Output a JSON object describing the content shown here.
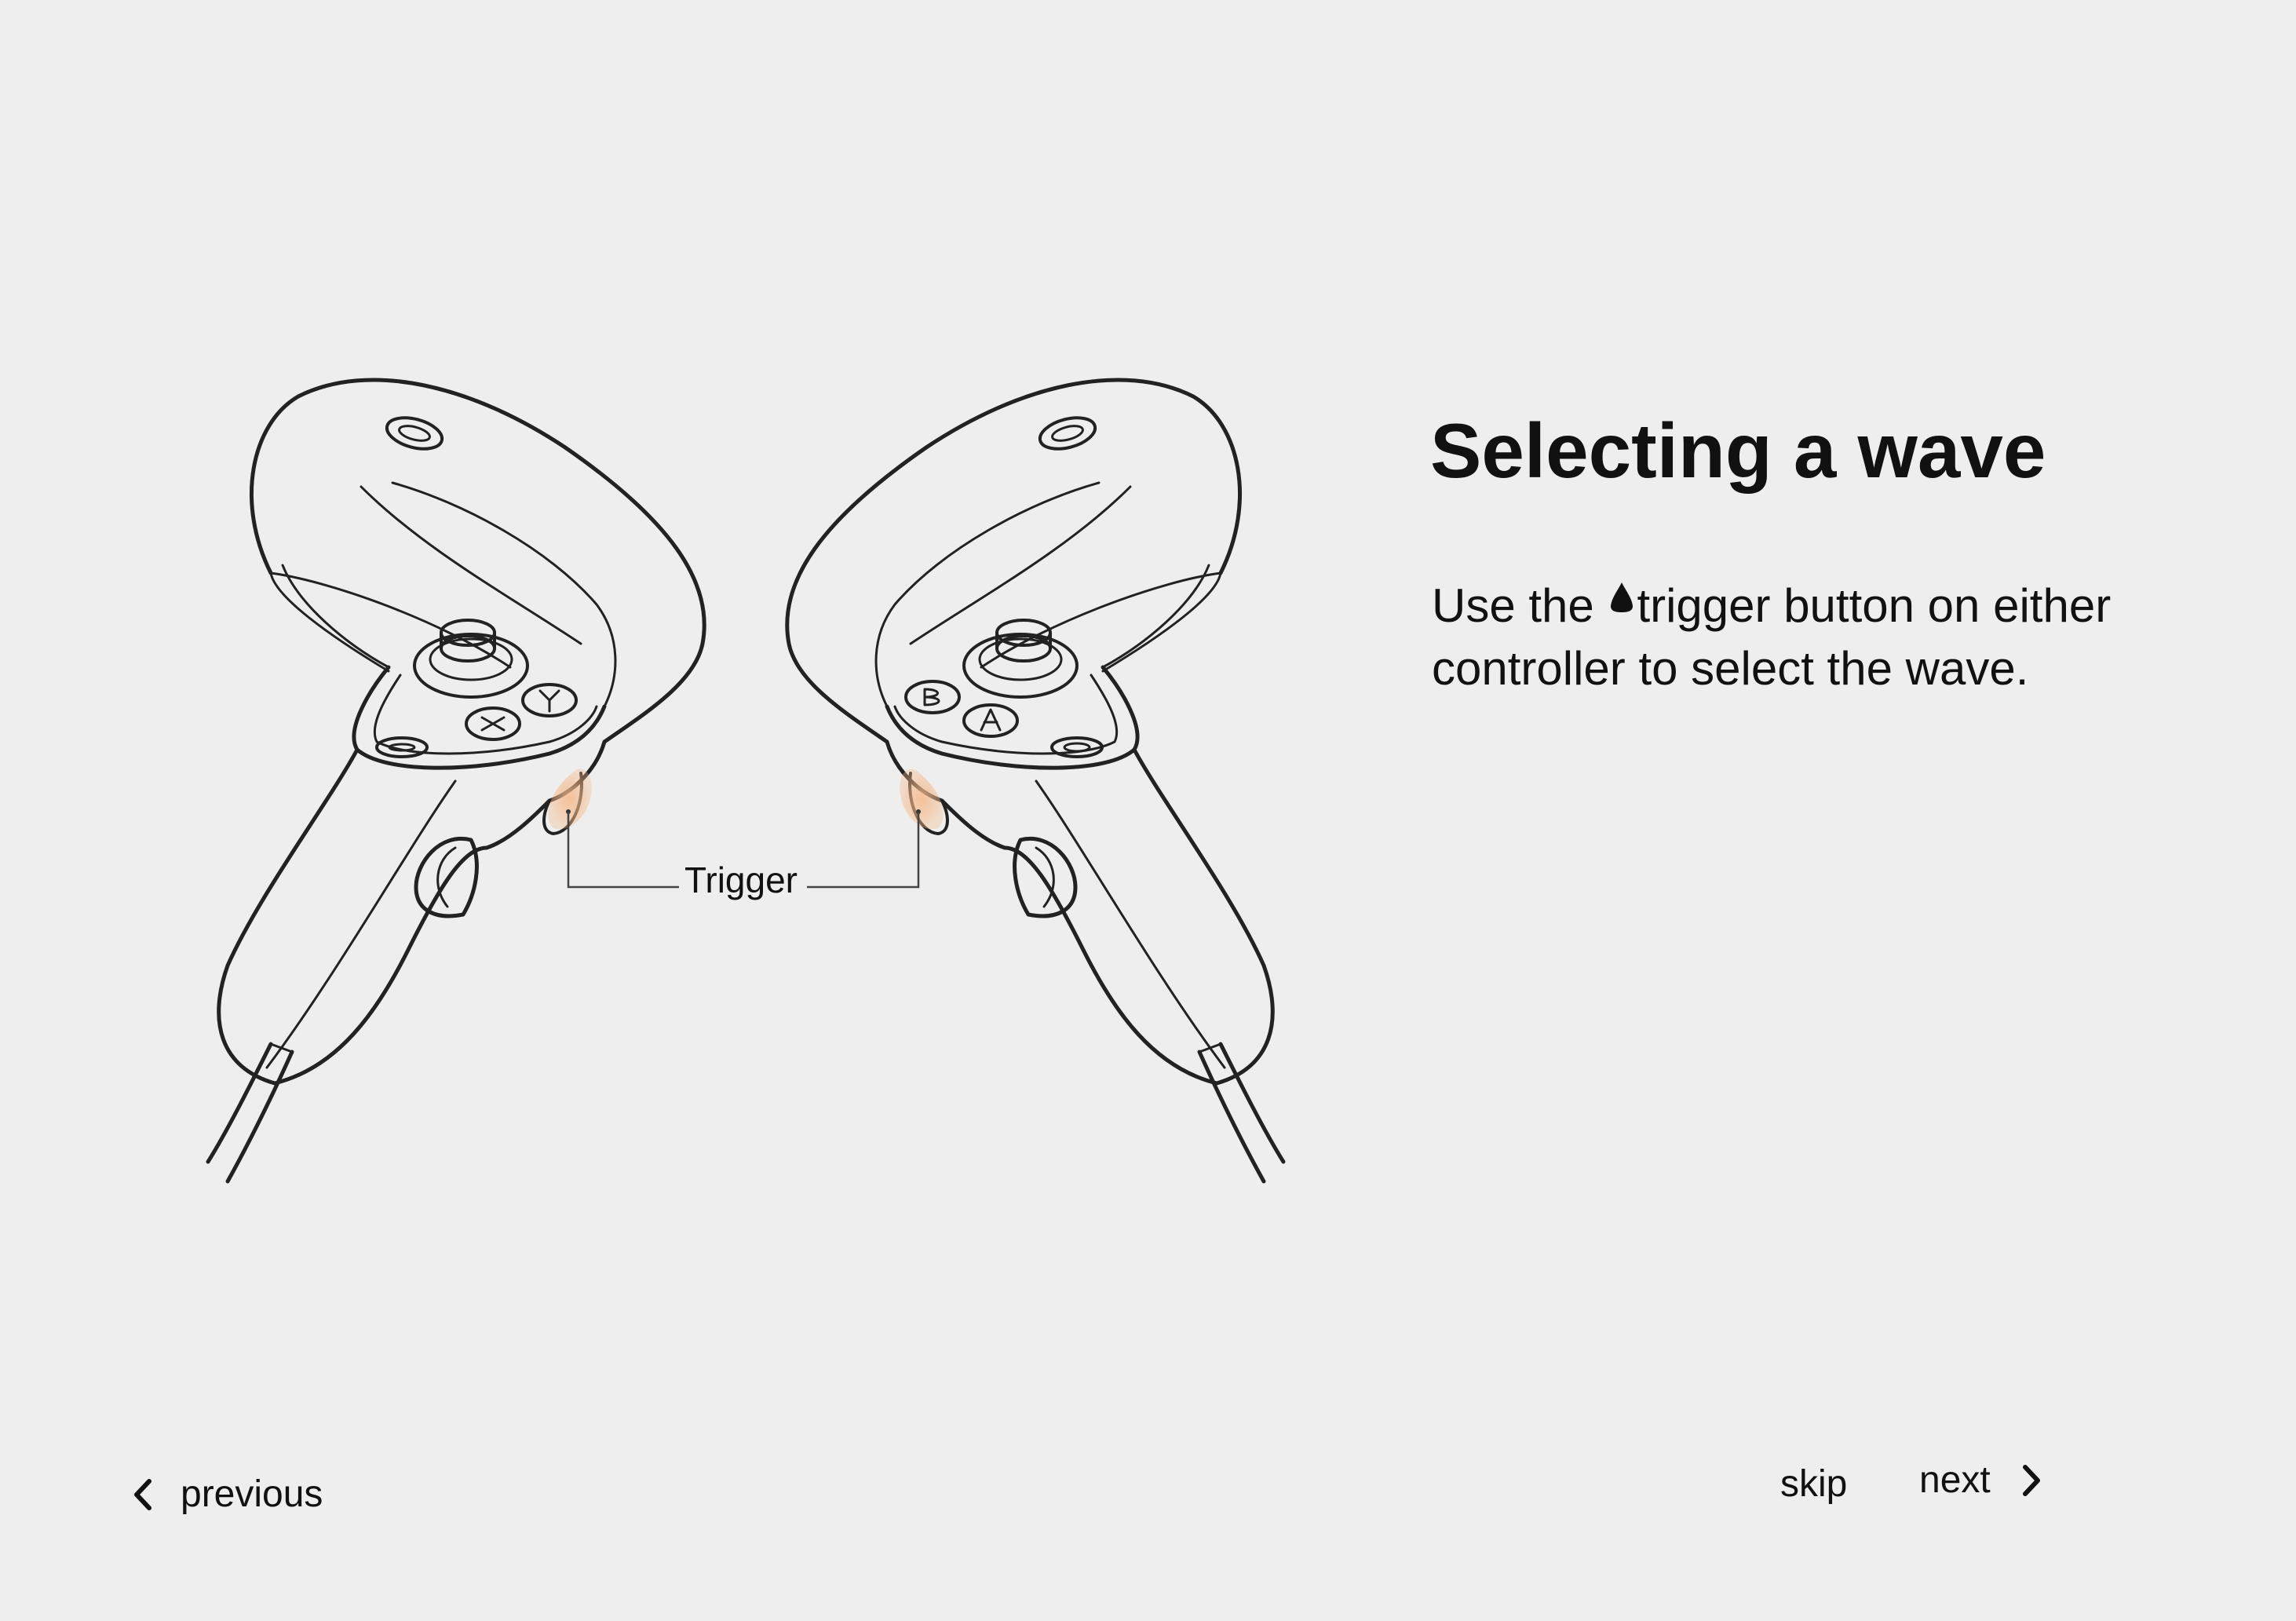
{
  "header": {
    "title": "Selecting a wave"
  },
  "instructions": {
    "before_icon": "Use the ",
    "icon": "trigger-icon",
    "after_icon": "trigger button on either controller to select the wave."
  },
  "illustration": {
    "trigger_label": "Trigger",
    "highlight_color": "#f5b98a"
  },
  "navigation": {
    "previous_label": "previous",
    "skip_label": "skip",
    "next_label": "next"
  }
}
